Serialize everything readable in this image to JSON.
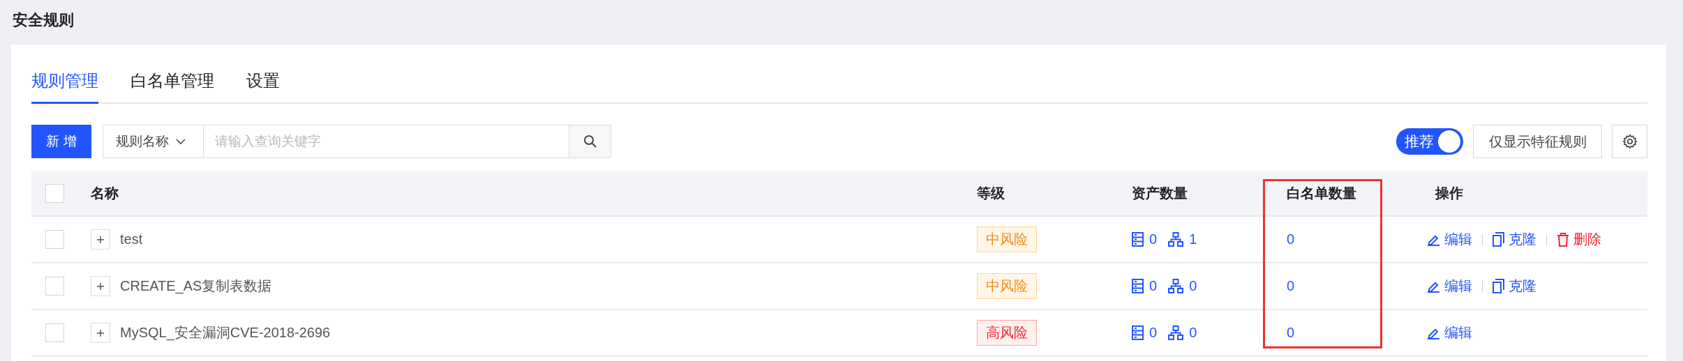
{
  "page_title": "安全规则",
  "tabs": [
    {
      "label": "规则管理",
      "selected": true
    },
    {
      "label": "白名单管理",
      "selected": false
    },
    {
      "label": "设置",
      "selected": false
    }
  ],
  "toolbar": {
    "add_button": "新 增",
    "filter_select": "规则名称",
    "search": {
      "placeholder": "请输入查询关键字"
    },
    "toggle": {
      "label": "推荐",
      "on": true
    },
    "feature_button": "仅显示特征规则"
  },
  "table": {
    "select_all": {
      "checked": false
    },
    "columns": [
      {
        "label": "名称",
        "highlighted": false
      },
      {
        "label": "等级",
        "highlighted": false
      },
      {
        "label": "资产数量",
        "highlighted": false
      },
      {
        "label": "白名单数量",
        "highlighted": true
      },
      {
        "label": "操作",
        "highlighted": false
      }
    ],
    "rows": [
      {
        "checked": false,
        "expanded": false,
        "name": "test",
        "level": {
          "label": "中风险",
          "kind": "medium"
        },
        "assets": [
          {
            "kind": "server",
            "count": "0"
          },
          {
            "kind": "network",
            "count": "1"
          }
        ],
        "whitelist": "0",
        "actions": [
          {
            "kind": "edit",
            "label": "编辑"
          },
          {
            "kind": "clone",
            "label": "克隆"
          },
          {
            "kind": "delete",
            "label": "删除"
          }
        ]
      },
      {
        "checked": false,
        "expanded": false,
        "name": "CREATE_AS复制表数据",
        "level": {
          "label": "中风险",
          "kind": "medium"
        },
        "assets": [
          {
            "kind": "server",
            "count": "0"
          },
          {
            "kind": "network",
            "count": "0"
          }
        ],
        "whitelist": "0",
        "actions": [
          {
            "kind": "edit",
            "label": "编辑"
          },
          {
            "kind": "clone",
            "label": "克隆"
          }
        ]
      },
      {
        "checked": false,
        "expanded": false,
        "name": "MySQL_安全漏洞CVE-2018-2696",
        "level": {
          "label": "高风险",
          "kind": "high"
        },
        "assets": [
          {
            "kind": "server",
            "count": "0"
          },
          {
            "kind": "network",
            "count": "0"
          }
        ],
        "whitelist": "0",
        "actions": [
          {
            "kind": "edit",
            "label": "编辑"
          }
        ]
      }
    ]
  }
}
